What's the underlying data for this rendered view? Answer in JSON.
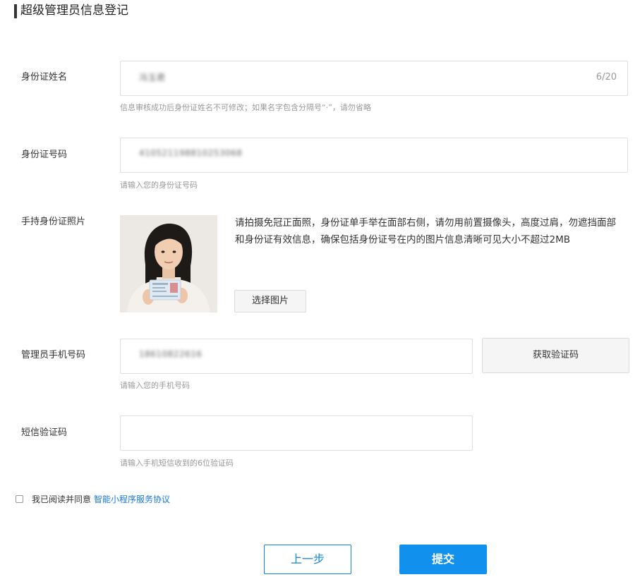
{
  "page_title": "超级管理员信息登记",
  "form": {
    "name": {
      "label": "身份证姓名",
      "value": "冯玉君",
      "counter": "6/20",
      "hint": "信息审核成功后身份证姓名不可修改；如果名字包含分隔号“·”，请勿省略"
    },
    "id_number": {
      "label": "身份证号码",
      "value": "410521198810253068",
      "hint": "请输入您的身份证号码"
    },
    "photo": {
      "label": "手持身份证照片",
      "description": "请拍摄免冠正面照，身份证单手举在面部右侧，请勿用前置摄像头，高度过肩，勿遮挡面部和身份证有效信息，确保包括身份证号在内的图片信息清晰可见大小不超过2MB",
      "select_button": "选择图片"
    },
    "phone": {
      "label": "管理员手机号码",
      "value": "18610822616",
      "hint": "请输入您的手机号码",
      "get_code_button": "获取验证码"
    },
    "sms_code": {
      "label": "短信验证码",
      "value": "",
      "hint": "请输入手机短信收到的6位验证码"
    }
  },
  "agreement": {
    "text": "我已阅读并同意",
    "link": "智能小程序服务协议",
    "checked": false
  },
  "buttons": {
    "prev": "上一步",
    "submit": "提交"
  },
  "colors": {
    "primary": "#1190ee",
    "link": "#1677e6",
    "hint": "#999999"
  }
}
